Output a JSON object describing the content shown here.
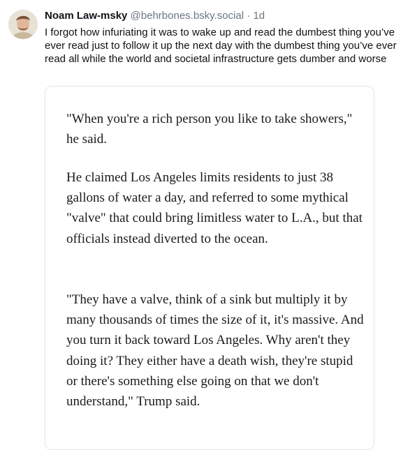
{
  "post": {
    "author": {
      "display_name": "Noam Law-msky",
      "handle": "@behrbones.bsky.social",
      "separator": "·",
      "time": "1d"
    },
    "text": "I forgot how infuriating it was to wake up and read the dumbest thing you’ve ever read just to follow it up the next day with the dumbest thing you’ve ever read all while the world and societal infrastructure gets dumber and worse",
    "embed": {
      "paragraphs": [
        "\"When you're a rich person you like to take showers,\" he said.",
        "He claimed Los Angeles limits residents to just 38 gallons of water a day, and referred to some mythical \"valve\" that could bring limitless water to L.A., but that officials instead diverted to the ocean.",
        "\"They have a valve, think of a sink but multiply it by many thousands of times the size of it, it's massive. And you turn it back toward Los Angeles. Why aren't they doing it? They either have a death wish, they're stupid or there's something else going on that we don't understand,\" Trump said."
      ]
    }
  }
}
